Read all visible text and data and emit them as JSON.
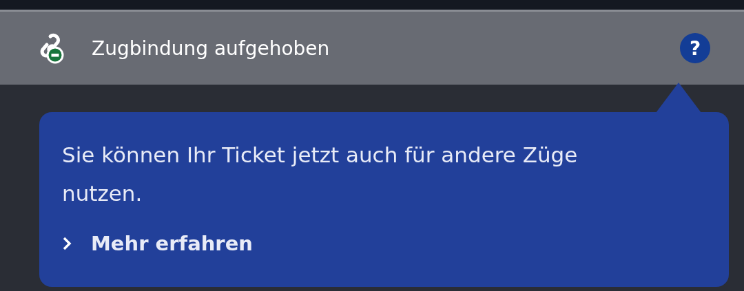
{
  "header": {
    "title": "Zugbindung aufgehoben",
    "help_button": {
      "label": "?"
    }
  },
  "tooltip": {
    "text": "Sie können Ihr Ticket jetzt auch für andere Züge nutzen.",
    "link": "Mehr erfahren"
  }
}
